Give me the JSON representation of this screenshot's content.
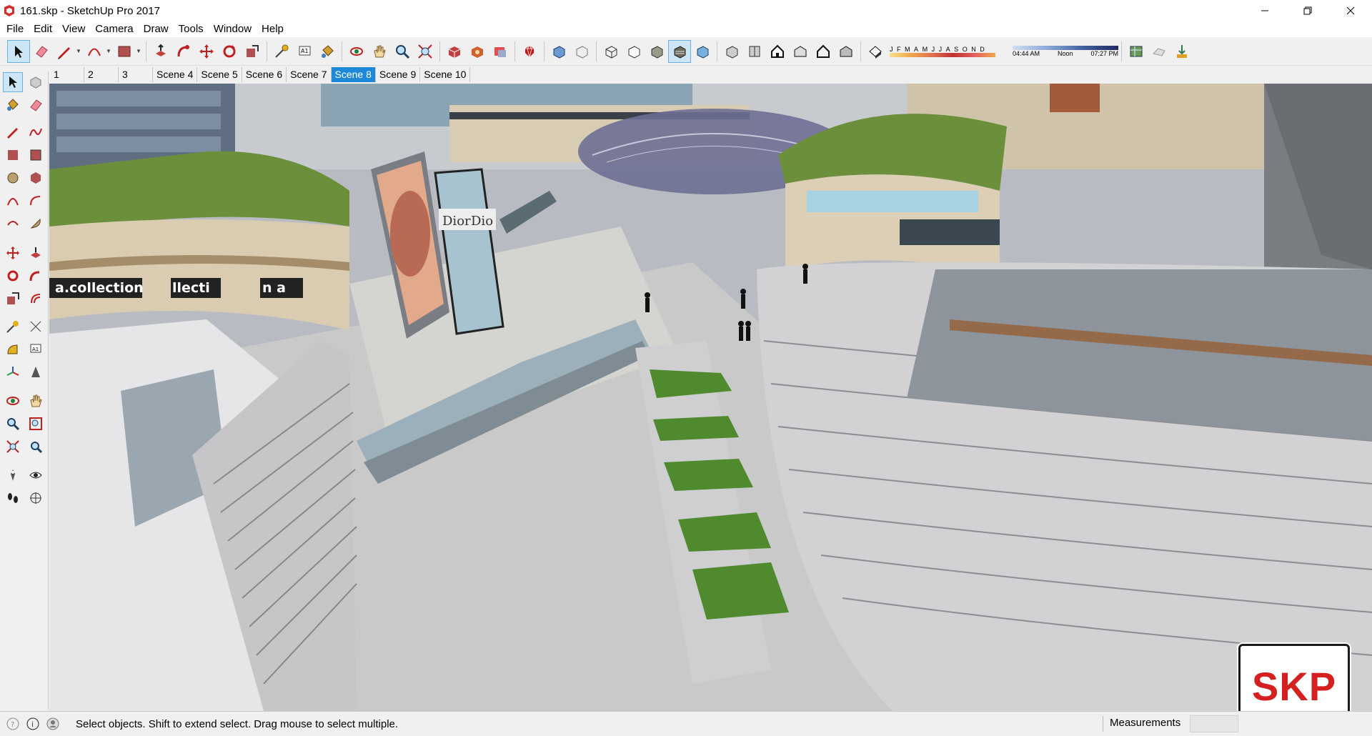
{
  "window": {
    "title": "161.skp - SketchUp Pro 2017"
  },
  "menu": [
    "File",
    "Edit",
    "View",
    "Camera",
    "Draw",
    "Tools",
    "Window",
    "Help"
  ],
  "shadow_panel": {
    "months": [
      "J",
      "F",
      "M",
      "A",
      "M",
      "J",
      "J",
      "A",
      "S",
      "O",
      "N",
      "D"
    ],
    "time_start": "04:44 AM",
    "time_mid": "Noon",
    "time_end": "07:27 PM"
  },
  "scenes": {
    "tabs": [
      "1",
      "2",
      "3",
      "Scene 4",
      "Scene 5",
      "Scene 6",
      "Scene 7",
      "Scene 8",
      "Scene 9",
      "Scene 10"
    ],
    "active": "Scene 8"
  },
  "viewport": {
    "signage": [
      "a.collection",
      "llecti",
      "n a",
      "Dior",
      "Dio"
    ],
    "watermark": "SKP"
  },
  "status": {
    "message": "Select objects. Shift to extend select. Drag mouse to select multiple.",
    "measurements_label": "Measurements",
    "measurements_value": ""
  },
  "colors": {
    "active_tab": "#1e88d8",
    "logo_red": "#d42020",
    "grass": "#5a8a2e"
  }
}
